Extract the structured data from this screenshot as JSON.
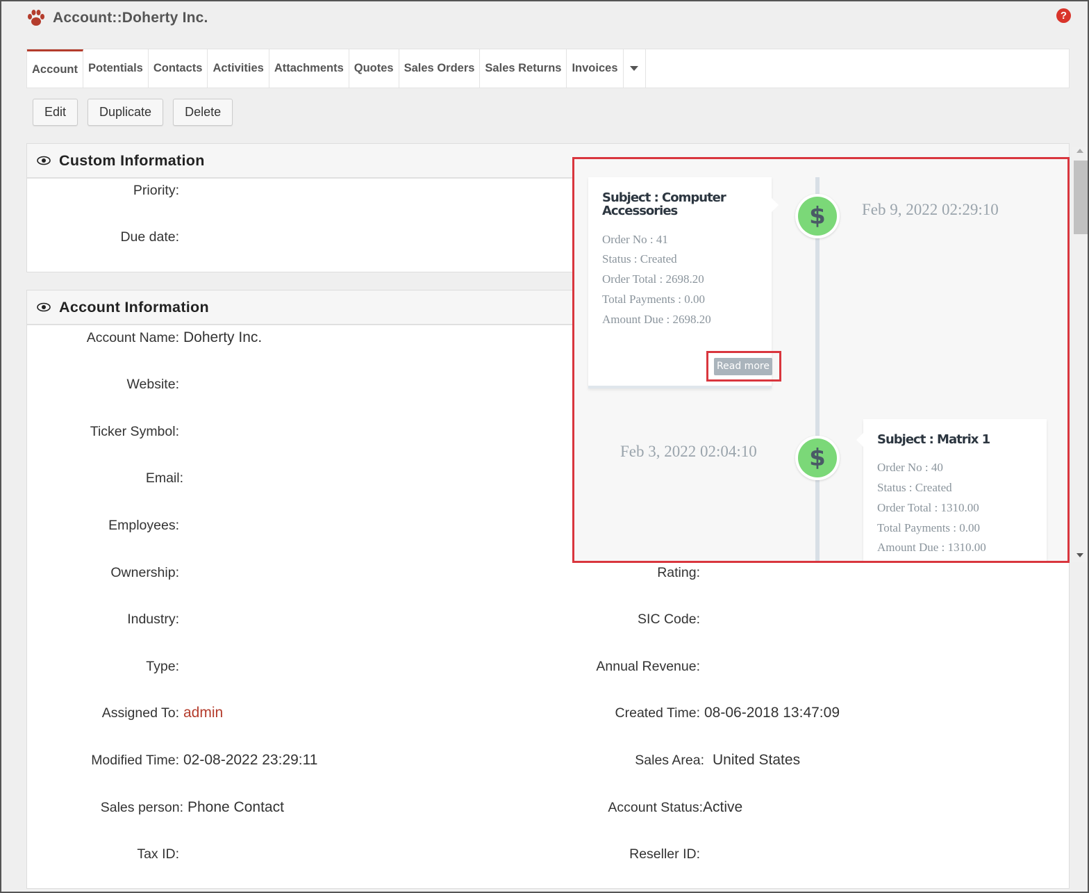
{
  "app": {
    "title": "Account::Doherty Inc.",
    "help_icon": "question-circle-icon",
    "logo_icon": "paw-icon",
    "accent_color": "#b43c2c"
  },
  "tabs": [
    {
      "label": "Account",
      "active": true
    },
    {
      "label": "Potentials"
    },
    {
      "label": "Contacts"
    },
    {
      "label": "Activities"
    },
    {
      "label": "Attachments"
    },
    {
      "label": "Quotes"
    },
    {
      "label": "Sales Orders"
    },
    {
      "label": "Sales Returns"
    },
    {
      "label": "Invoices"
    }
  ],
  "actions": {
    "edit": "Edit",
    "duplicate": "Duplicate",
    "delete": "Delete"
  },
  "custom_info": {
    "title": "Custom Information",
    "priority_label": "Priority:",
    "due_date_label": "Due date:"
  },
  "account_info": {
    "title": "Account Information",
    "account_name_label": "Account Name:",
    "account_name": "Doherty Inc.",
    "website_label": "Website:",
    "ticker_label": "Ticker Symbol:",
    "email_label": "Email:",
    "employees_label": "Employees:",
    "ownership_label": "Ownership:",
    "rating_label": "Rating:",
    "industry_label": "Industry:",
    "sic_label": "SIC Code:",
    "type_label": "Type:",
    "revenue_label": "Annual Revenue:",
    "assigned_label": "Assigned To:",
    "assigned_value": "admin",
    "created_label": "Created Time:",
    "created_value": "08-06-2018 13:47:09",
    "modified_label": "Modified Time:",
    "modified_value": "02-08-2022 23:29:11",
    "sales_area_label": "Sales Area:",
    "sales_area_value": "United States",
    "sales_person_label": "Sales person:",
    "sales_person_value": "Phone Contact",
    "status_label": "Account Status:",
    "status_value": "Active",
    "tax_label": "Tax ID:",
    "reseller_label": "Reseller ID:"
  },
  "timeline": {
    "icon": "dollar-icon",
    "dot_color": "#7bd878",
    "entries": [
      {
        "date": "Feb 9, 2022 02:29:10",
        "subject": "Subject : Computer Accessories",
        "subject_line1": "Subject : Computer",
        "subject_line2": "Accessories",
        "order_no": "Order No : 41",
        "status": "Status : Created",
        "order_total": "Order Total : 2698.20",
        "total_payments": "Total Payments : 0.00",
        "amount_due": "Amount Due : 2698.20",
        "read_more": "Read more"
      },
      {
        "date": "Feb 3, 2022 02:04:10",
        "subject": "Subject : Matrix 1",
        "order_no": "Order No : 40",
        "status": "Status : Created",
        "order_total": "Order Total : 1310.00",
        "total_payments": "Total Payments : 0.00",
        "amount_due": "Amount Due : 1310.00"
      }
    ]
  }
}
